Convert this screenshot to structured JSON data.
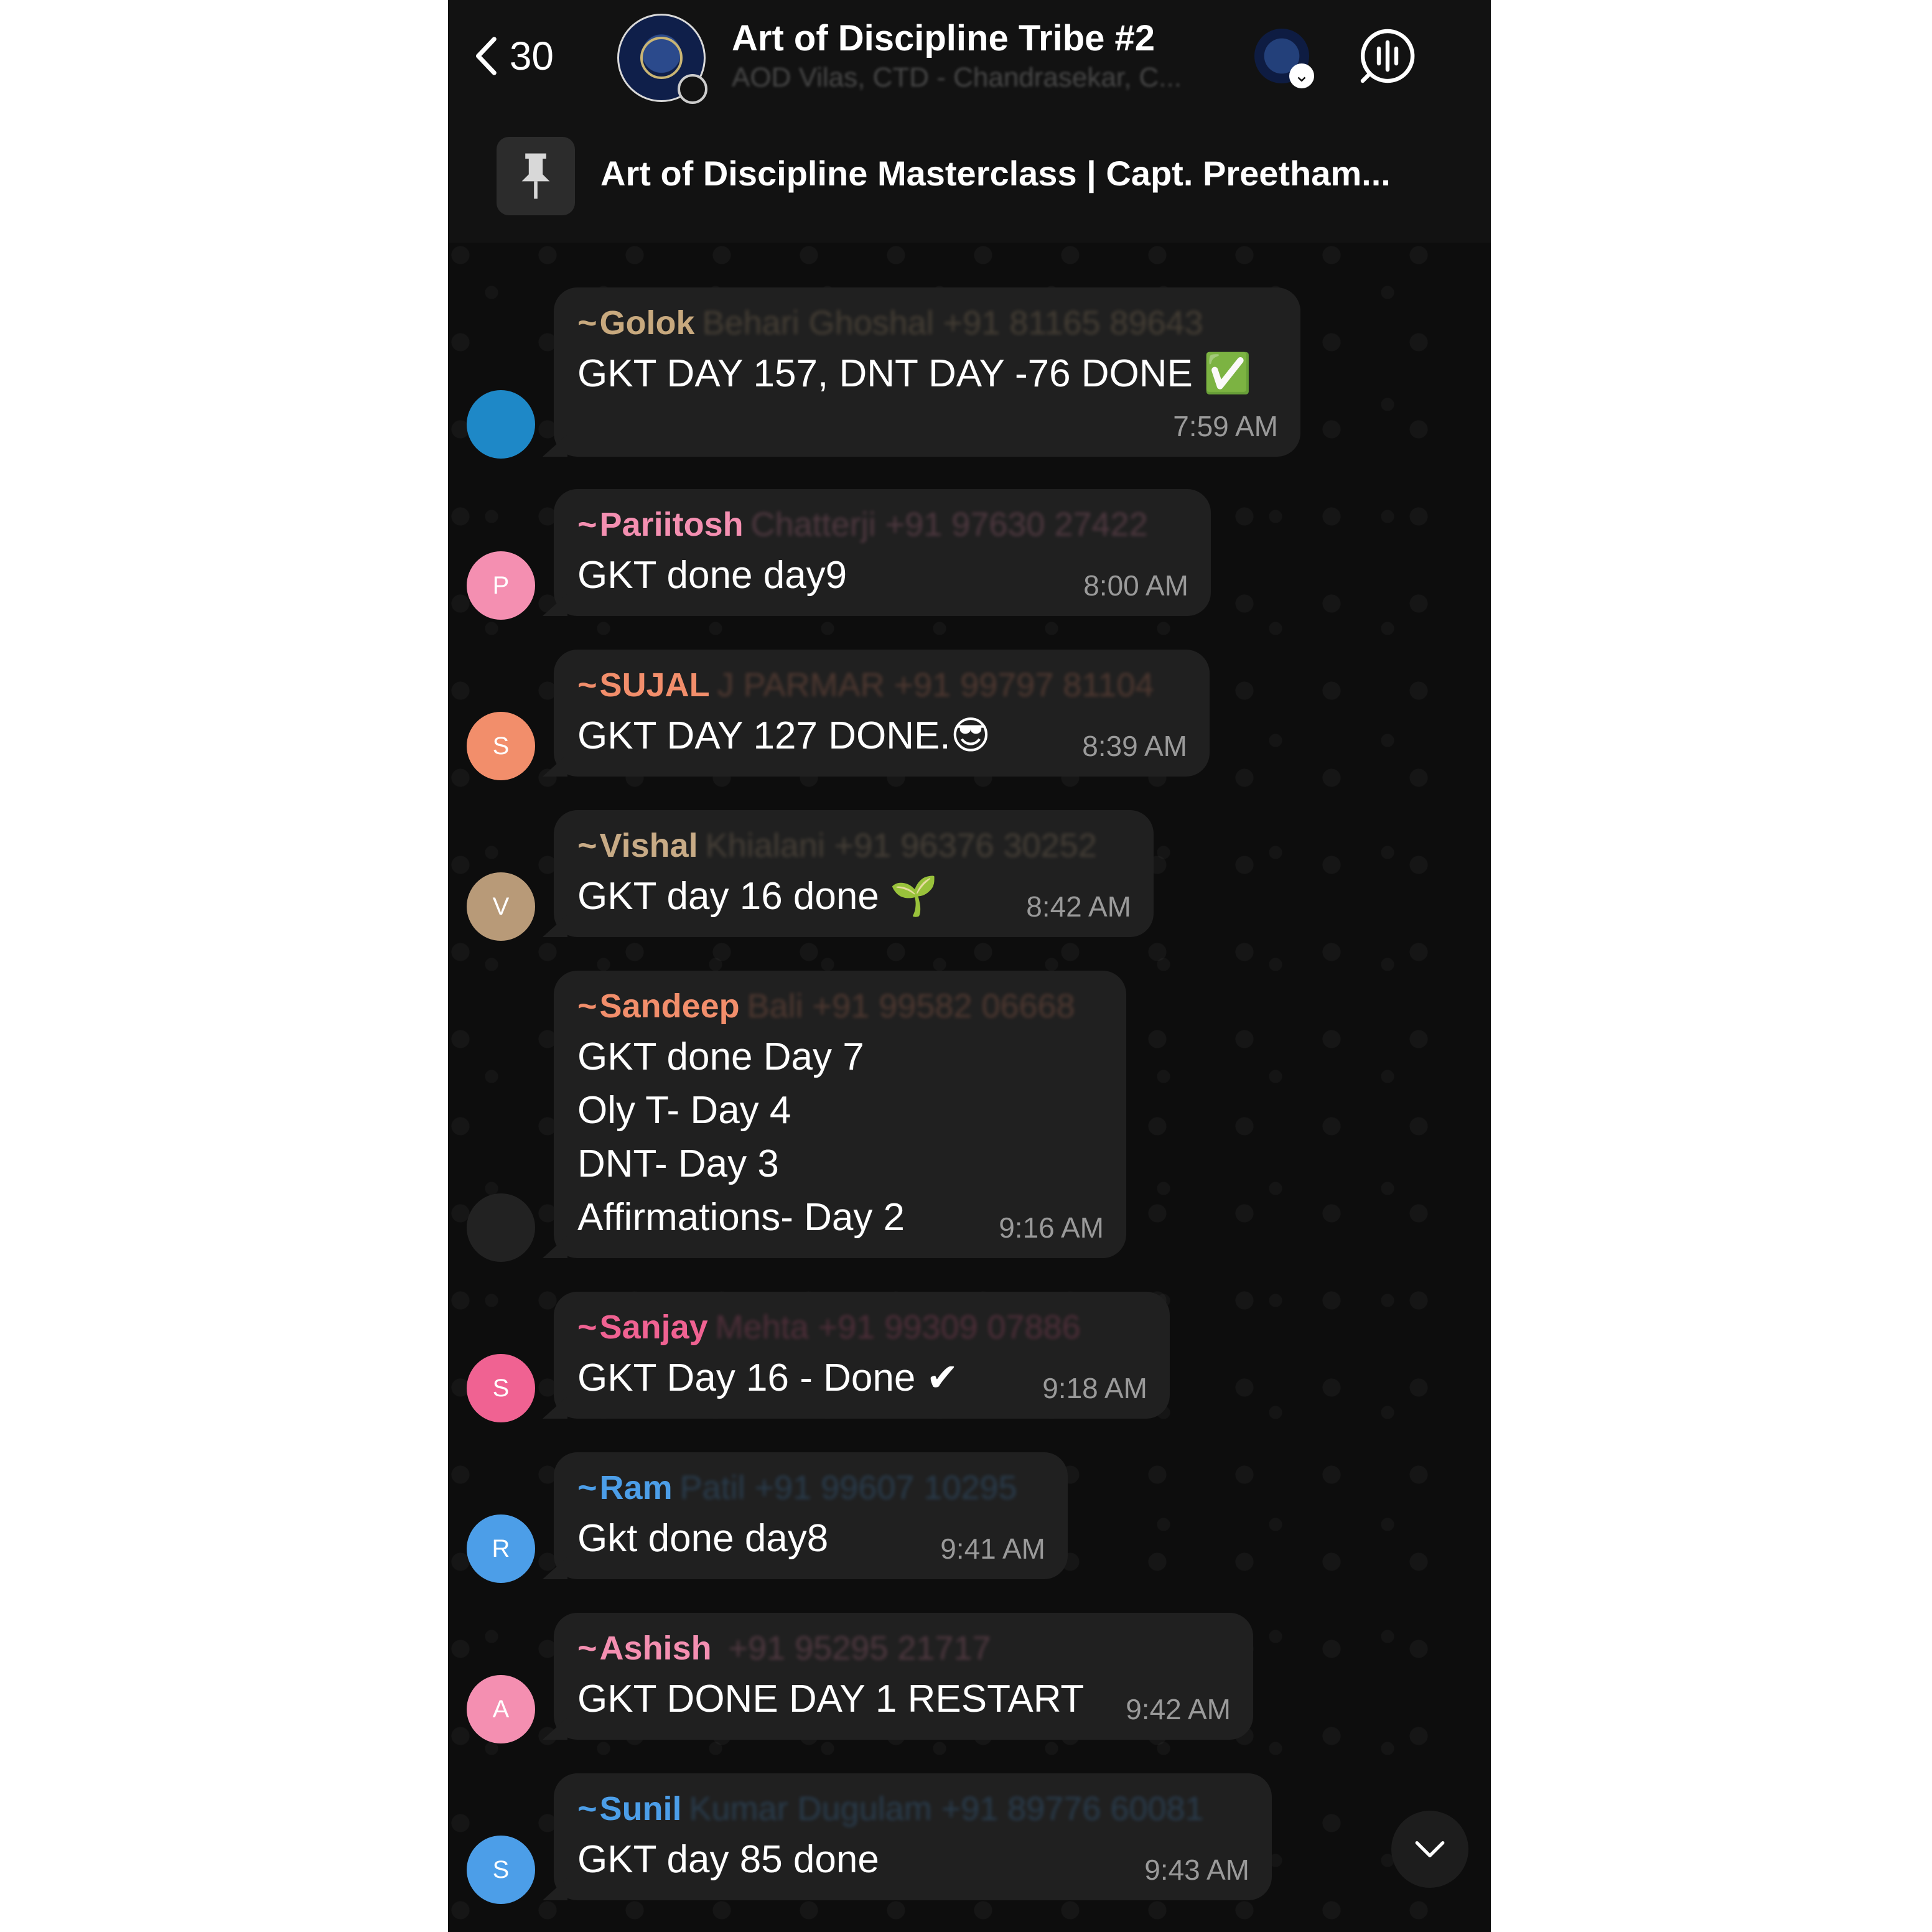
{
  "header": {
    "back_count": "30",
    "title": "Art of Discipline Tribe #2",
    "subtitle": "AOD Vilas, CTD - Chandrasekar, C..."
  },
  "pinned": {
    "text": "Art of Discipline Masterclass | Capt. Preetham..."
  },
  "messages": [
    {
      "first": "Golok",
      "rest": "Behari Ghoshal    +91 81165 89643",
      "text": "GKT DAY 157, DNT DAY -76 DONE ✅",
      "time": "7:59 AM",
      "color": "#c8a97e",
      "avatar_initial": "",
      "avatar_color": "#1e88c7"
    },
    {
      "first": "Pariitosh",
      "rest": "Chatterji +91 97630 27422",
      "text": "GKT done day9",
      "time": "8:00 AM",
      "color": "#f48fb1",
      "avatar_initial": "P",
      "avatar_color": "#f48fb1"
    },
    {
      "first": "SUJAL",
      "rest": "J PARMAR +91 99797 81104",
      "text": "GKT DAY 127 DONE.😎",
      "time": "8:39 AM",
      "color": "#f28e6b",
      "avatar_initial": "S",
      "avatar_color": "#f28e6b"
    },
    {
      "first": "Vishal",
      "rest": "Khialani +91 96376 30252",
      "text": "GKT day 16 done 🌱",
      "time": "8:42 AM",
      "color": "#c8ab86",
      "avatar_initial": "V",
      "avatar_color": "#b89a78"
    },
    {
      "first": "Sandeep",
      "rest": "Bali +91 99582 06668",
      "text": "GKT done Day 7\nOly T- Day 4\nDNT- Day 3\nAffirmations- Day 2",
      "time": "9:16 AM",
      "color": "#f28e6b",
      "avatar_initial": "",
      "avatar_color": "#222222"
    },
    {
      "first": "Sanjay",
      "rest": "Mehta        +91 99309 07886",
      "text": "GKT Day 16 - Done ✔",
      "time": "9:18 AM",
      "color": "#f06292",
      "avatar_initial": "S",
      "avatar_color": "#f06292"
    },
    {
      "first": "Ram",
      "rest": "Patil +91 99607 10295",
      "text": "Gkt done day8",
      "time": "9:41 AM",
      "color": "#4c9ee8",
      "avatar_initial": "R",
      "avatar_color": "#4c9ee8"
    },
    {
      "first": "Ashish",
      "rest": "              +91 95295 21717",
      "text": "GKT DONE DAY 1 RESTART",
      "time": "9:42 AM",
      "color": "#f48fb1",
      "avatar_initial": "A",
      "avatar_color": "#f48fb1"
    },
    {
      "first": "Sunil",
      "rest": "Kumar Dugulam +91 89776 60081",
      "text": "GKT day 85 done",
      "time": "9:43 AM",
      "color": "#4c9ee8",
      "avatar_initial": "S",
      "avatar_color": "#4c9ee8"
    }
  ]
}
